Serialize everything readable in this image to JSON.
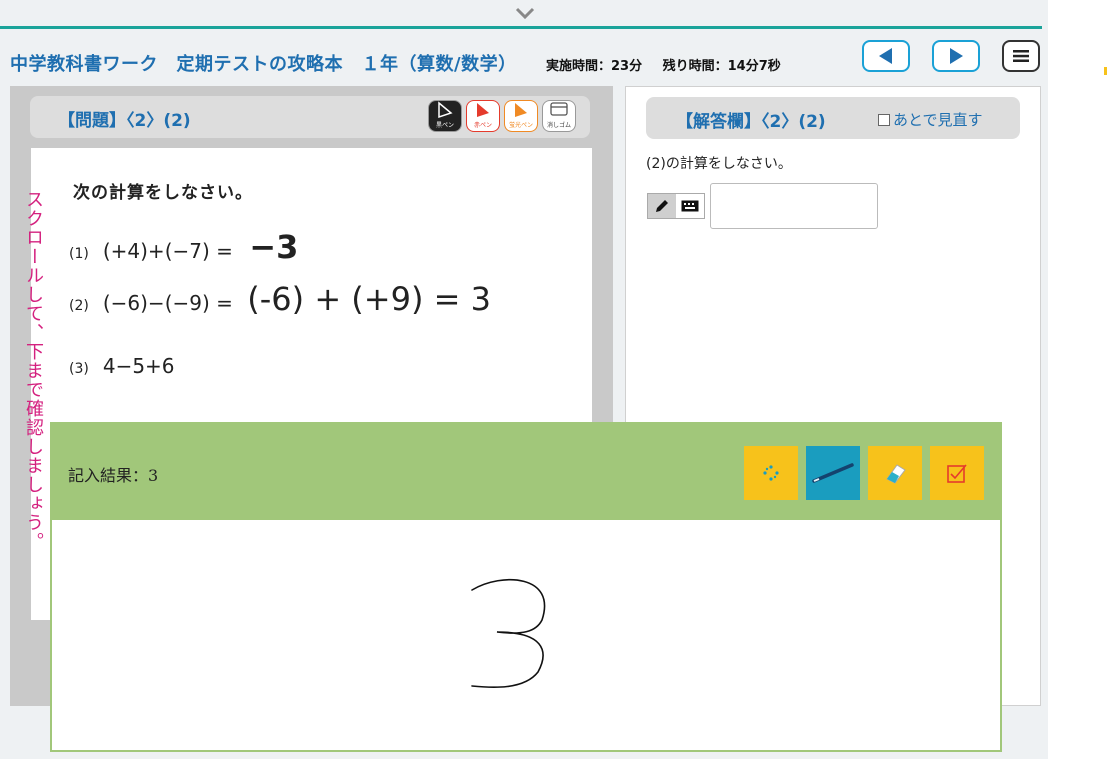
{
  "header": {
    "title": "中学教科書ワーク　定期テストの攻略本　１年（算数/数学）",
    "elapsed": "実施時間：23分",
    "remaining": "残り時間：14分7秒"
  },
  "question": {
    "label": "【問題】〈2〉(2)",
    "tools": [
      {
        "name": "黒ペン",
        "color": "#222222"
      },
      {
        "name": "赤ペン",
        "color": "#e53b2c"
      },
      {
        "name": "蛍光ペン",
        "color": "#f08a24"
      },
      {
        "name": "消しゴム",
        "color": "#ffffff"
      }
    ],
    "instruction": "次の計算をしなさい。",
    "items": [
      {
        "num": "(1)",
        "expr": "(+4)+(−7) =",
        "handwriting": "−3"
      },
      {
        "num": "(2)",
        "expr": "(−6)−(−9) =",
        "handwriting": "(-6) + (+9) = 3"
      },
      {
        "num": "(3)",
        "expr": "4−5+6"
      }
    ],
    "scroll_hint": "スクロールして、下まで確認しましょう。"
  },
  "answer": {
    "label": "【解答欄】〈2〉(2)",
    "review_label": "あとで見直す",
    "prompt": "(2)の計算をしなさい。",
    "value": ""
  },
  "popup": {
    "result_label": "記入結果：",
    "result_value": "3",
    "tools": [
      "sparkle-icon",
      "pen-icon",
      "eraser-icon",
      "confirm-icon"
    ],
    "handwritten": "3"
  }
}
